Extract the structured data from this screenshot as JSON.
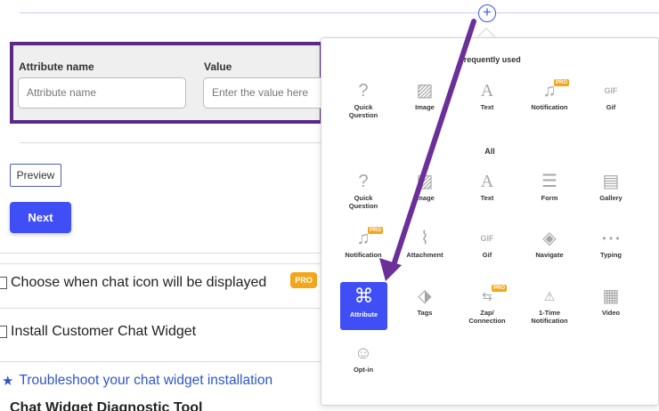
{
  "attribute": {
    "name_label": "Attribute name",
    "name_placeholder": "Attribute name",
    "value_label": "Value",
    "value_placeholder": "Enter the value here"
  },
  "buttons": {
    "preview": "Preview",
    "next": "Next"
  },
  "sections": {
    "chat_icon": "Choose when chat icon will be displayed",
    "chat_icon_badge": "PRO",
    "install": "Install Customer Chat Widget",
    "troubleshoot": "Troubleshoot your chat widget installation",
    "diagnostic": "Chat Widget Diagnostic Tool"
  },
  "panel": {
    "frequently_used_heading": "Frequently used",
    "all_heading": "All",
    "frequent": [
      "Quick Question",
      "Image",
      "Text",
      "Notification",
      "Gif"
    ],
    "all_row1": [
      "Quick Question",
      "Image",
      "Text",
      "Form",
      "Gallery"
    ],
    "all_row2": [
      "Notification",
      "Attachment",
      "Gif",
      "Navigate",
      "Typing"
    ],
    "all_row3": [
      "Attribute",
      "Tags",
      "Zap/ Connection",
      "1-Time Notification",
      "Video"
    ],
    "all_row4": [
      "Opt-in"
    ],
    "pro_badge": "PRO",
    "gif_icon_text": "GIF"
  },
  "colors": {
    "accent": "#3f4ff5",
    "highlight_border": "#5b2a86",
    "pro": "#f2a61c",
    "link": "#2e57c5"
  }
}
